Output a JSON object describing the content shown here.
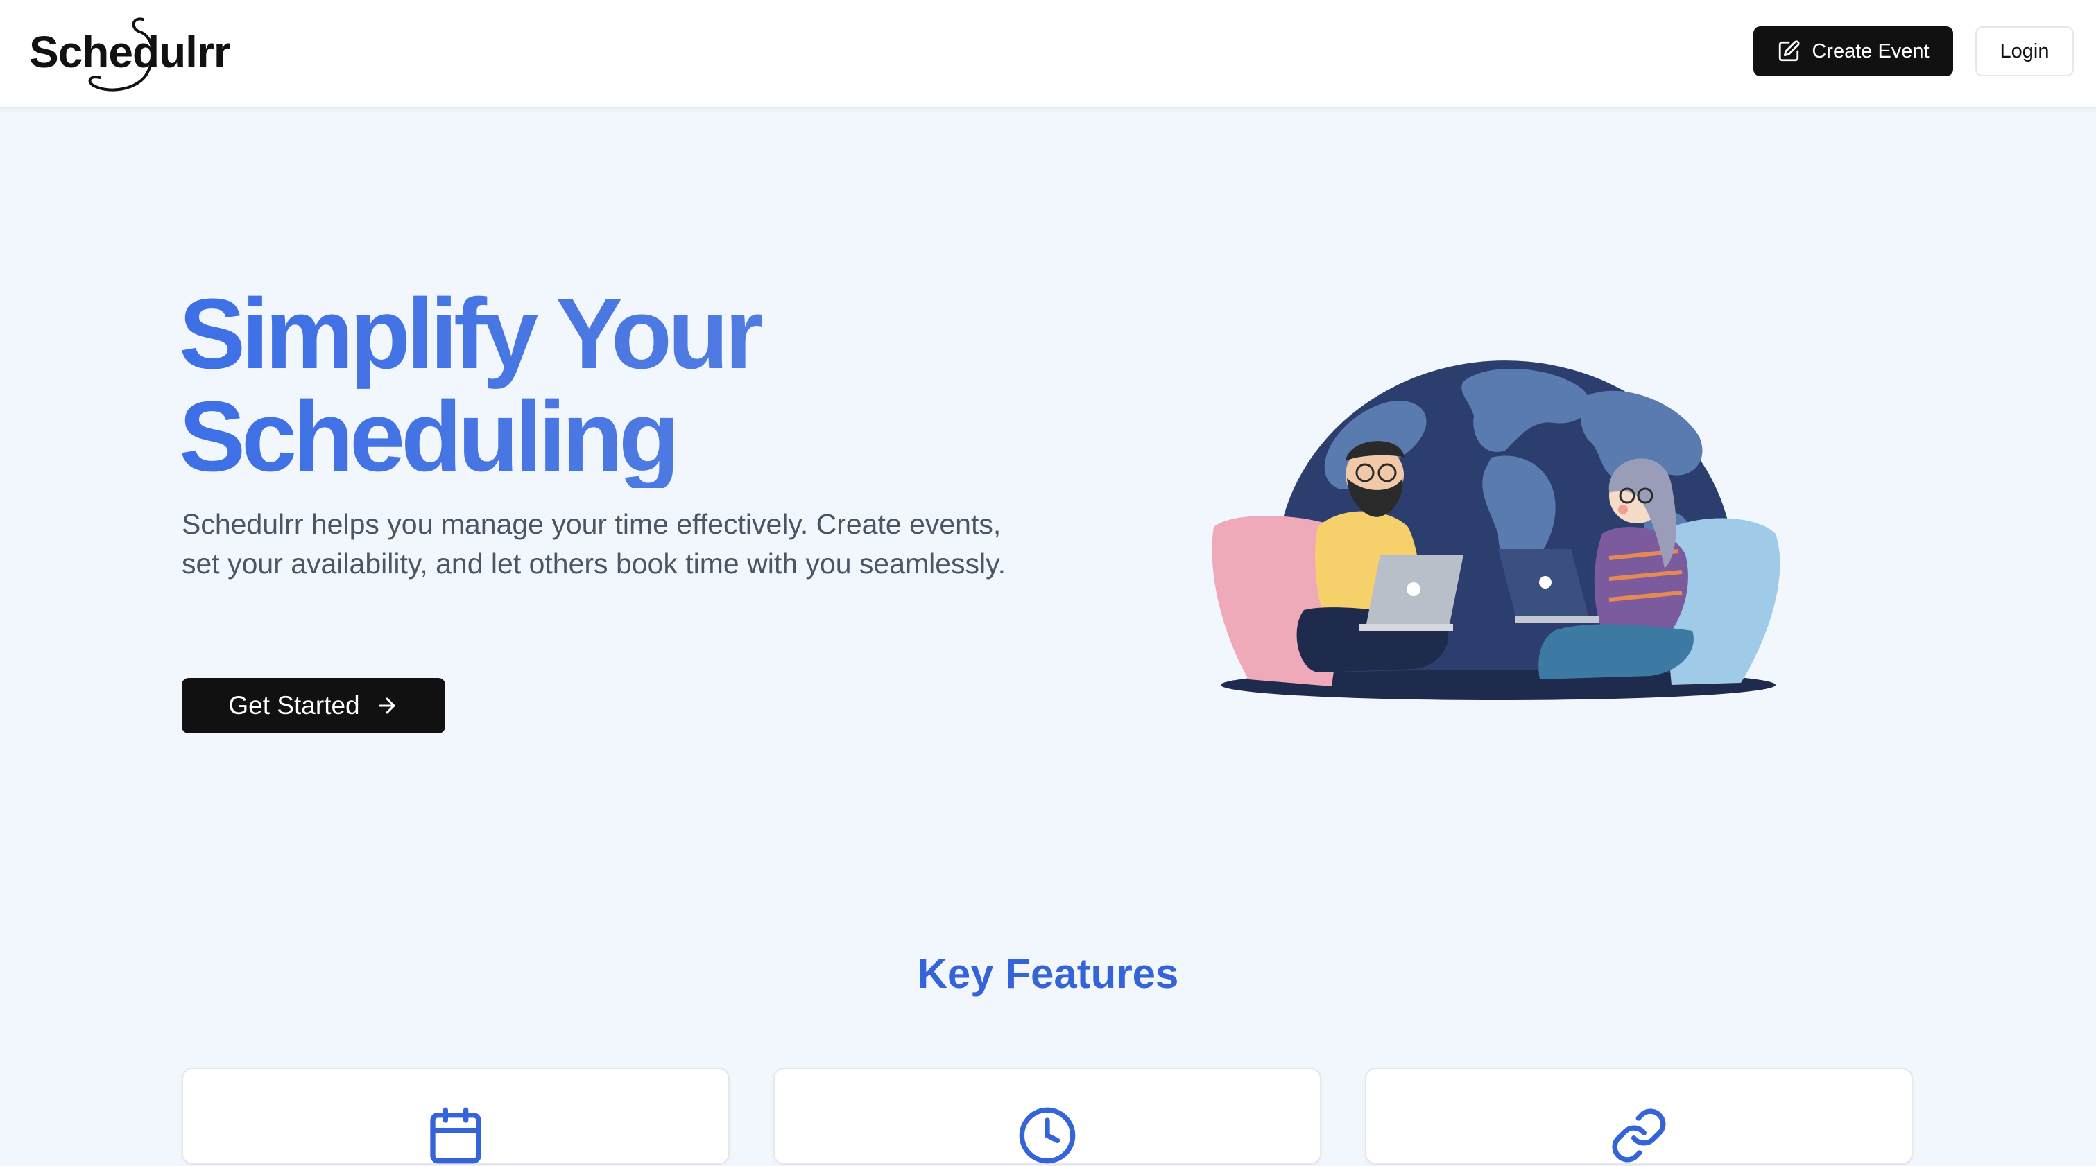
{
  "header": {
    "logo_text": "Schedulrr",
    "create_event_label": "Create Event",
    "login_label": "Login"
  },
  "hero": {
    "title_line1": "Simplify Your",
    "title_line2": "Scheduling",
    "description": "Schedulrr helps you manage your time effectively. Create events, set your availability, and let others book time with you seamlessly.",
    "cta_label": "Get Started"
  },
  "features": {
    "title": "Key Features",
    "cards": [
      {
        "icon": "calendar-icon"
      },
      {
        "icon": "clock-icon"
      },
      {
        "icon": "link-icon"
      }
    ]
  },
  "colors": {
    "accent": "#4775e4",
    "features_title": "#3563d8",
    "button_dark": "#111111",
    "page_bg": "#f2f6fd"
  }
}
